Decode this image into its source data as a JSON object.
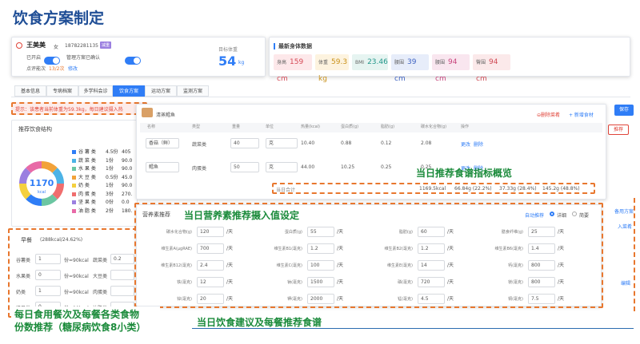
{
  "slide_title": "饮食方案制定",
  "patient": {
    "name": "王美美",
    "gender": "女",
    "phone": "18782281135",
    "tag": "减重",
    "opened_label": "已开启",
    "manage_label": "管理方案已确认",
    "clock_label": "点评能次",
    "clock_value": "13/2次",
    "clock_link": "修改",
    "target_weight_label": "目标体重",
    "target_weight_value": "54",
    "target_weight_unit": "kg"
  },
  "body_data": {
    "title": "最新身体数据",
    "metrics": [
      {
        "label": "身高",
        "value": "159 cm",
        "bg": "#fde8ea",
        "color": "#d64a57"
      },
      {
        "label": "体重",
        "value": "59.3 kg",
        "bg": "#fdf3df",
        "color": "#c9911a"
      },
      {
        "label": "BMI",
        "value": "23.46",
        "bg": "#e6f4f1",
        "color": "#23978a"
      },
      {
        "label": "腰围",
        "value": "39 cm",
        "bg": "#e7edfa",
        "color": "#3f63c2"
      },
      {
        "label": "腰围",
        "value": "94 cm",
        "bg": "#f9e6ef",
        "color": "#c8457d"
      },
      {
        "label": "臀围",
        "value": "94 cm",
        "bg": "#fbe9ea",
        "color": "#d04b55"
      }
    ]
  },
  "tabs": [
    "基本信息",
    "专病档案",
    "多学科会诊",
    "饮食方案",
    "运动方案",
    "监测方案"
  ],
  "tip": "提示：该患者当前体重为59.3kg，每日建议摄入热",
  "save_label": "保存",
  "structure_title": "推荐饮食结构",
  "donut": {
    "value": "1170",
    "unit": "kcal"
  },
  "donut_colors": [
    "#f2a23a",
    "#4cb3e6",
    "#f06e6e",
    "#6bc6a2",
    "#2f7df6",
    "#f4d03f",
    "#9b7fe0",
    "#e86aa7"
  ],
  "legend": [
    {
      "color": "#2f7df6",
      "label": "谷 薯 类",
      "value": "4.5份",
      "extra": "405"
    },
    {
      "color": "#4cb3e6",
      "label": "蔬 菜 类",
      "value": "1份",
      "extra": "90.0"
    },
    {
      "color": "#6bc6a2",
      "label": "水 果 类",
      "value": "1份",
      "extra": "90.0"
    },
    {
      "color": "#f2a23a",
      "label": "大 豆 类",
      "value": "0.5份",
      "extra": "45.0"
    },
    {
      "color": "#f4d03f",
      "label": "奶 类",
      "value": "1份",
      "extra": "90.0"
    },
    {
      "color": "#f06e6e",
      "label": "肉 蛋 类",
      "value": "3份",
      "extra": "270."
    },
    {
      "color": "#9b7fe0",
      "label": "坚 果 类",
      "value": "0份",
      "extra": "0.0"
    },
    {
      "color": "#e86aa7",
      "label": "油 脂 类",
      "value": "2份",
      "extra": "180."
    }
  ],
  "breakfast": {
    "title": "早餐",
    "kcal": "(288kcal/24.62%)",
    "rows": [
      {
        "label": "谷薯类",
        "value": "1",
        "note": "份=90kcal",
        "label2": "蔬菜类",
        "value2": "0.2"
      },
      {
        "label": "水果类",
        "value": "0",
        "note": "份=90kcal",
        "label2": "大豆类",
        "value2": ""
      },
      {
        "label": "奶类",
        "value": "1",
        "note": "份=90kcal",
        "label2": "肉蛋类",
        "value2": ""
      },
      {
        "label": "坚果类",
        "value": "0",
        "note": "份=90kcal",
        "label2": "油脂类",
        "value2": ""
      }
    ]
  },
  "recipe": {
    "dish_name": "清蒸鳕鱼",
    "delete_dish": "⊖删除菜肴",
    "add_food": "+ 新增食材",
    "headers": [
      "名称",
      "类型",
      "重量",
      "单位",
      "热量(kcal)",
      "蛋白质(g)",
      "脂肪(g)",
      "碳水化合物(g)",
      "操作"
    ],
    "rows": [
      {
        "name": "香菇（鲜）",
        "type": "蔬菜类",
        "weight": "40",
        "unit": "克",
        "kcal": "10.40",
        "protein": "0.88",
        "fat": "0.12",
        "carb": "2.08",
        "op1": "更改",
        "op2": "删除"
      },
      {
        "name": "鳕鱼",
        "type": "肉蛋类",
        "weight": "50",
        "unit": "克",
        "kcal": "44.00",
        "protein": "10.25",
        "fat": "0.25",
        "carb": "0.25",
        "op1": "更改",
        "op2": "删除"
      }
    ],
    "summary_label": "当日合计",
    "summary_kcal": "1169.5kcal",
    "summary_protein": "66.84g (22.2%)",
    "summary_fat": "37.33g (28.4%)",
    "summary_carb": "145.2g (48.8%)"
  },
  "nutrients": {
    "title": "营养素推荐",
    "switch_label": "自动推荐",
    "mode_detail": "详细",
    "mode_brief": "简要",
    "rows": [
      [
        {
          "label": "碳水化合物(g)",
          "value": "120",
          "unit": "/天"
        },
        {
          "label": "蛋白质(g)",
          "value": "55",
          "unit": "/天"
        },
        {
          "label": "脂肪(g)",
          "value": "60",
          "unit": "/天"
        },
        {
          "label": "膳食纤维(g)",
          "value": "25",
          "unit": "/天"
        }
      ],
      [
        {
          "label": "维生素A(μgRAE)",
          "value": "700",
          "unit": "/天"
        },
        {
          "label": "维生素B1(毫克)",
          "value": "1.2",
          "unit": "/天"
        },
        {
          "label": "维生素B2(毫克)",
          "value": "1.2",
          "unit": "/天"
        },
        {
          "label": "维生素B6(毫克)",
          "value": "1.4",
          "unit": "/天"
        }
      ],
      [
        {
          "label": "维生素B12(毫克)",
          "value": "2.4",
          "unit": "/天"
        },
        {
          "label": "维生素C(毫克)",
          "value": "100",
          "unit": "/天"
        },
        {
          "label": "维生素E(毫克)",
          "value": "14",
          "unit": "/天"
        },
        {
          "label": "钙(毫克)",
          "value": "800",
          "unit": "/天"
        }
      ],
      [
        {
          "label": "铁(毫克)",
          "value": "12",
          "unit": "/天"
        },
        {
          "label": "钠(毫克)",
          "value": "1500",
          "unit": "/天"
        },
        {
          "label": "磷(毫克)",
          "value": "720",
          "unit": "/天"
        },
        {
          "label": "镁(毫克)",
          "value": "800",
          "unit": "/天"
        }
      ],
      [
        {
          "label": "锌(毫克)",
          "value": "20",
          "unit": "/天"
        },
        {
          "label": "钾(毫克)",
          "value": "2000",
          "unit": "/天"
        },
        {
          "label": "锰(毫克)",
          "value": "4.5",
          "unit": "/天"
        },
        {
          "label": "铜(毫克)",
          "value": "7.5",
          "unit": "/天"
        }
      ]
    ]
  },
  "callouts": {
    "recipe_overview": "当日推荐食谱指标概览",
    "nutrient_setting": "当日营养素推荐摄入值设定",
    "portion_line1": "每日食用餐次及每餐各类食物",
    "portion_line2": "份数推荐（糖尿病饮食8小类）",
    "daily_advice": "当日饮食建议及每餐推荐食谱"
  },
  "right_edge": {
    "btn": "推荐",
    "link1": "备用方案",
    "link2": "入菜肴",
    "link3": "编辑"
  }
}
